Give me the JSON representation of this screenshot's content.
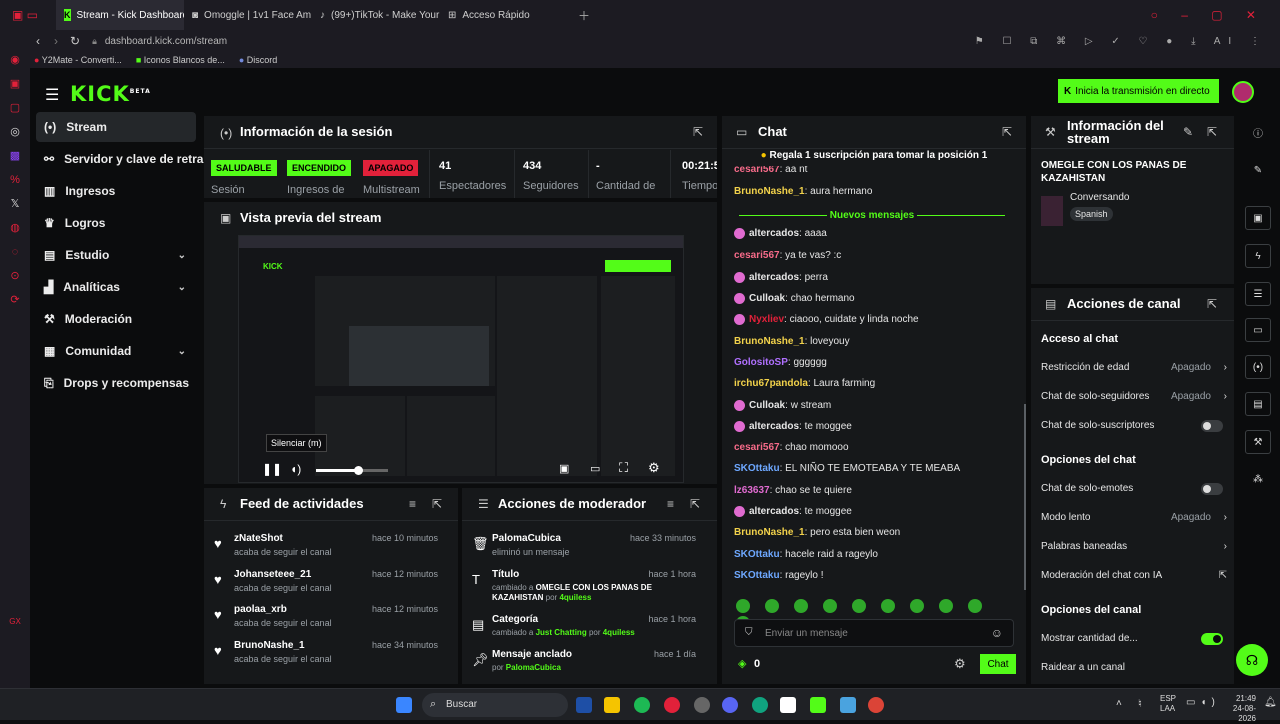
{
  "browser": {
    "tabs": [
      {
        "label": "Stream - Kick Dashboard",
        "active": true
      },
      {
        "label": "Omoggle | 1v1 Face Am"
      },
      {
        "label": "(99+)TikTok - Make Your D"
      },
      {
        "label": "Acceso Rápido"
      }
    ],
    "url": "dashboard.kick.com/stream",
    "bookmarks": [
      "Y2Mate - Converti...",
      "Iconos Blancos de...",
      "Discord"
    ]
  },
  "app": {
    "logo": "KICK",
    "logo_beta": "BETA",
    "go_live_button": "Inicia la transmisión en directo",
    "nav": [
      {
        "label": "Stream",
        "active": true
      },
      {
        "label": "Servidor y clave de retransmisión"
      },
      {
        "label": "Ingresos"
      },
      {
        "label": "Logros"
      },
      {
        "label": "Estudio",
        "has_sub": true
      },
      {
        "label": "Analíticas",
        "has_sub": true
      },
      {
        "label": "Moderación"
      },
      {
        "label": "Comunidad",
        "has_sub": true
      },
      {
        "label": "Drops y recompensas"
      }
    ]
  },
  "session": {
    "title": "Información de la sesión",
    "stats": [
      {
        "value": "SALUDABLE",
        "label": "Sesión",
        "badge": true,
        "color": "#53fc18"
      },
      {
        "value": "ENCENDIDO",
        "label": "Ingresos de",
        "badge": true,
        "color": "#53fc18"
      },
      {
        "value": "APAGADO",
        "label": "Multistream",
        "badge": true,
        "color": "#e2213a"
      },
      {
        "value": "41",
        "label": "Espectadores"
      },
      {
        "value": "434",
        "label": "Seguidores"
      },
      {
        "value": "-",
        "label": "Cantidad de"
      },
      {
        "value": "00:21:5",
        "label": "Tiempo"
      }
    ]
  },
  "preview": {
    "title": "Vista previa del stream",
    "tooltip": "Silenciar (m)",
    "volume_fraction": 0.58
  },
  "feed": {
    "title": "Feed de actividades",
    "items": [
      {
        "name": "zNateShot",
        "sub": "acaba de seguir el canal",
        "time": "hace 10 minutos"
      },
      {
        "name": "Johanseteee_21",
        "sub": "acaba de seguir el canal",
        "time": "hace 12 minutos"
      },
      {
        "name": "paolaa_xrb",
        "sub": "acaba de seguir el canal",
        "time": "hace 12 minutos"
      },
      {
        "name": "BrunoNashe_1",
        "sub": "acaba de seguir el canal",
        "time": "hace 34 minutos"
      }
    ]
  },
  "moderator": {
    "title": "Acciones de moderador",
    "items": [
      {
        "name": "PalomaCubica",
        "sub": "eliminó un mensaje",
        "time": "hace 33 minutos"
      },
      {
        "name": "Título",
        "sub_prefix": "cambiado a",
        "sub_value": "OMEGLE CON LOS PANAS DE KAZAHISTAN",
        "sub_by": "por",
        "sub_user": "4quiless",
        "time": "hace 1 hora"
      },
      {
        "name": "Categoría",
        "sub_prefix": "cambiado a",
        "sub_value": "Just Chatting",
        "sub_by": "por",
        "sub_user": "4quiless",
        "time": "hace 1 hora"
      },
      {
        "name": "Mensaje anclado",
        "sub_by": "por",
        "sub_user": "PalomaCubica",
        "time": "hace 1 día"
      }
    ]
  },
  "chat": {
    "title": "Chat",
    "pinned": "Regala 1 suscripción para tomar la posición 1",
    "new_messages": "Nuevos mensajes",
    "messages": [
      {
        "user": "cesari567",
        "text": "aa nt",
        "color": "#f76b8a"
      },
      {
        "user": "BrunoNashe_1",
        "text": "aura hermano",
        "color": "#f2d24b"
      },
      {
        "user": "altercados",
        "text": "aaaa",
        "color": "#e6e6e6",
        "badge": true
      },
      {
        "user": "cesari567",
        "text": "ya te vas? :c",
        "color": "#f76b8a"
      },
      {
        "user": "altercados",
        "text": "perra",
        "color": "#e6e6e6",
        "badge": true
      },
      {
        "user": "Culloak",
        "text": "chao hermano",
        "color": "#e6e6e6",
        "badge": true
      },
      {
        "user": "Nyxliev",
        "text": "ciaooo, cuidate y linda noche",
        "color": "#e2213a",
        "badge": true
      },
      {
        "user": "BrunoNashe_1",
        "text": "loveyouy",
        "color": "#f2d24b"
      },
      {
        "user": "GolositoSP",
        "text": "gggggg",
        "color": "#b070ff"
      },
      {
        "user": "irchu67pandola",
        "text": "Laura farming",
        "color": "#f2d24b"
      },
      {
        "user": "Culloak",
        "text": "w stream",
        "color": "#e6e6e6",
        "badge": true
      },
      {
        "user": "altercados",
        "text": "te moggee",
        "color": "#e6e6e6",
        "badge": true
      },
      {
        "user": "cesari567",
        "text": "chao momooo",
        "color": "#f76b8a"
      },
      {
        "user": "SKOttaku",
        "text": "EL NIÑO TE EMOTEABA Y TE MEABA",
        "color": "#6ea8ff"
      },
      {
        "user": "lz63637",
        "text": "chao se te quiere",
        "color": "#e06bd0"
      },
      {
        "user": "altercados",
        "text": "te moggee",
        "color": "#e6e6e6",
        "badge": true
      },
      {
        "user": "BrunoNashe_1",
        "text": "pero esta bien weon",
        "color": "#f2d24b"
      },
      {
        "user": "SKOttaku",
        "text": "hacele raid a rageylo",
        "color": "#6ea8ff"
      },
      {
        "user": "SKOttaku",
        "text": "rageylo !",
        "color": "#6ea8ff"
      }
    ],
    "input_placeholder": "Enviar un mensaje",
    "points": "0",
    "send_button": "Chat"
  },
  "stream_info": {
    "title": "Información del stream",
    "stream_title": "OMEGLE CON LOS PANAS DE KAZAHISTAN",
    "category": "Conversando",
    "language": "Spanish"
  },
  "channel_actions": {
    "title": "Acciones de canal",
    "sections": [
      {
        "heading": "Acceso al chat",
        "rows": [
          {
            "label": "Restricción de edad",
            "value": "Apagado",
            "type": "arrow"
          },
          {
            "label": "Chat de solo-seguidores",
            "value": "Apagado",
            "type": "arrow"
          },
          {
            "label": "Chat de solo-suscriptores",
            "type": "toggle",
            "on": false
          }
        ]
      },
      {
        "heading": "Opciones del chat",
        "rows": [
          {
            "label": "Chat de solo-emotes",
            "type": "toggle",
            "on": false
          },
          {
            "label": "Modo lento",
            "value": "Apagado",
            "type": "arrow"
          },
          {
            "label": "Palabras baneadas",
            "type": "arrow"
          },
          {
            "label": "Moderación del chat con IA",
            "type": "external"
          }
        ]
      },
      {
        "heading": "Opciones del canal",
        "rows": [
          {
            "label": "Mostrar cantidad de...",
            "type": "toggle",
            "on": true
          },
          {
            "label": "Raidear a un canal",
            "type": "none"
          }
        ]
      }
    ]
  },
  "taskbar": {
    "search_placeholder": "Buscar",
    "lang": "ESP",
    "lang2": "LAA",
    "time": "21:49",
    "date": "24-08-2026"
  }
}
